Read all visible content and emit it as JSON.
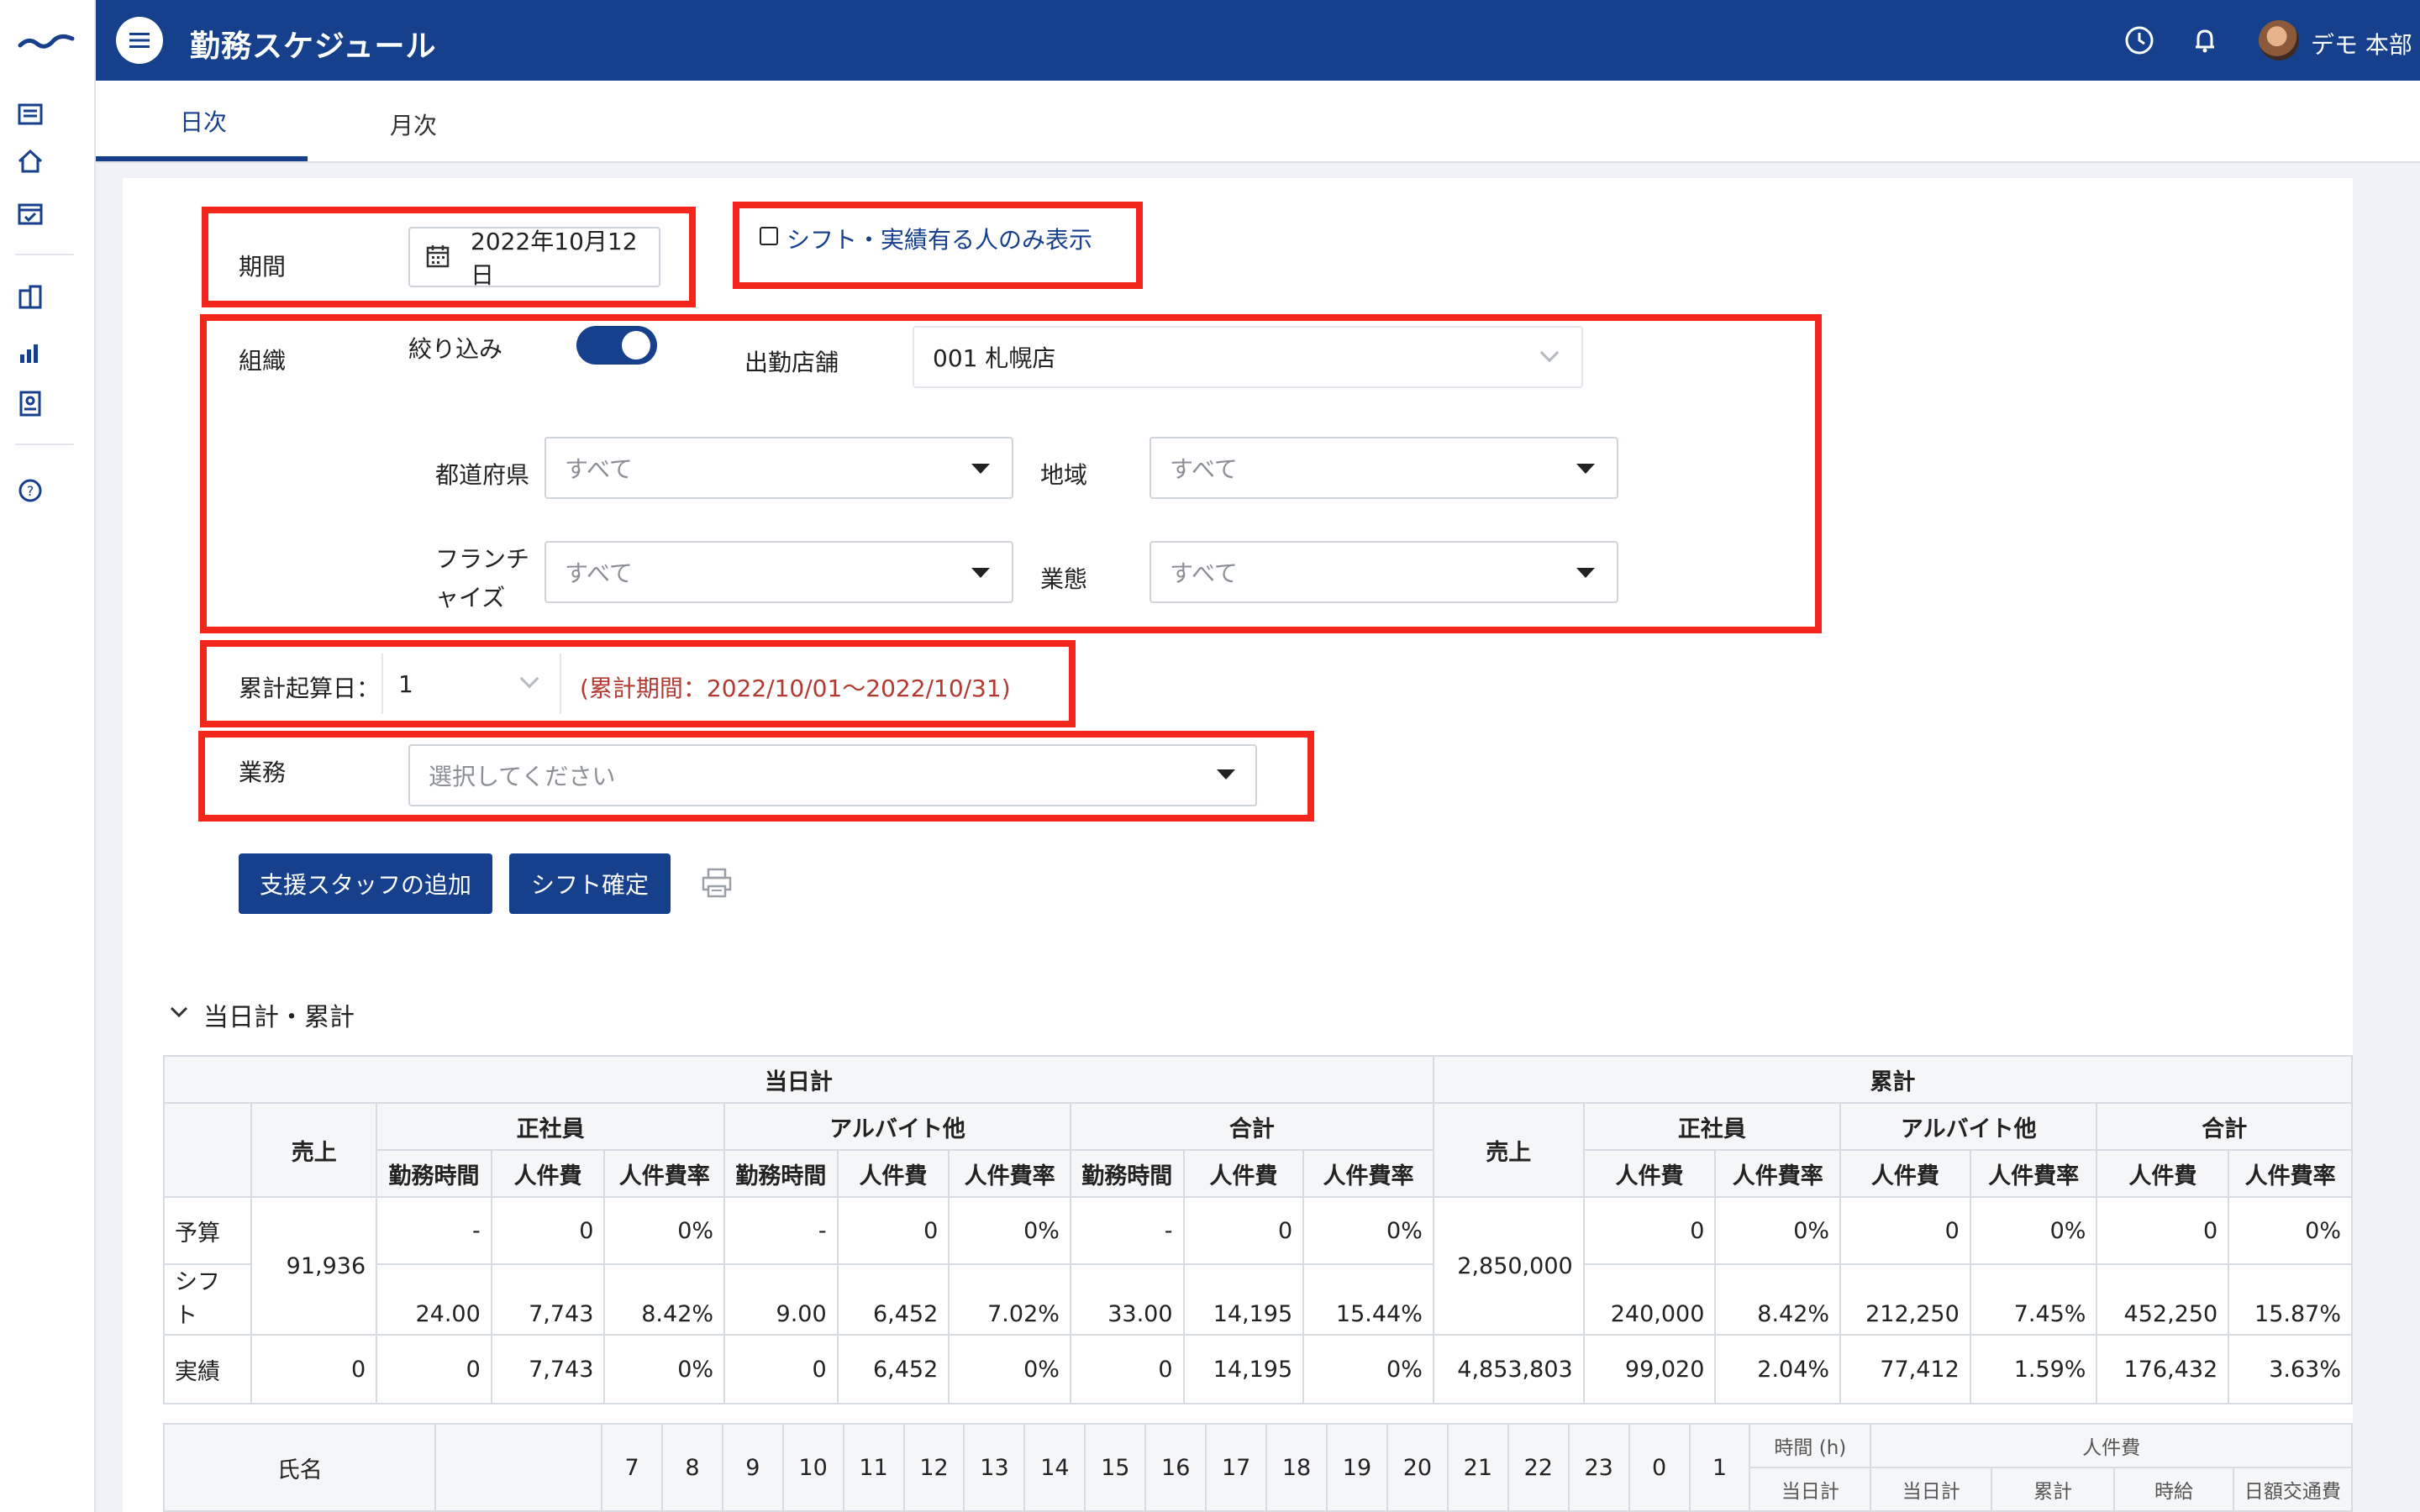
{
  "header": {
    "title": "勤務スケジュール",
    "user_name": "デモ 本部"
  },
  "tabs": [
    {
      "label": "日次",
      "active": true
    },
    {
      "label": "月次",
      "active": false
    }
  ],
  "filters": {
    "period_label": "期間",
    "period_value": "2022年10月12日",
    "shift_only_label": "シフト・実績有る人のみ表示",
    "org_label": "組織",
    "narrow_label": "絞り込み",
    "narrow_on": true,
    "store_label": "出勤店舗",
    "store_value": "001 札幌店",
    "pref_label": "都道府県",
    "pref_value": "すべて",
    "region_label": "地域",
    "region_value": "すべて",
    "franchise_label_1": "フランチ",
    "franchise_label_2": "ャイズ",
    "franchise_value": "すべて",
    "business_type_label": "業態",
    "business_type_value": "すべて",
    "cumulative_label": "累計起算日：",
    "cumulative_value": "1",
    "cumulative_period": "(累計期間：2022/10/01〜2022/10/31)",
    "work_label": "業務",
    "work_placeholder": "選択してください"
  },
  "actions": {
    "add_support_staff": "支援スタッフの追加",
    "confirm_shift": "シフト確定"
  },
  "summary_section": {
    "title": "当日計・累計",
    "groups": {
      "daily": "当日計",
      "cumulative": "累計"
    },
    "col_sales": "売上",
    "col_regular": "正社員",
    "col_part": "アルバイト他",
    "col_total": "合計",
    "col_hours": "勤務時間",
    "col_cost": "人件費",
    "col_rate": "人件費率",
    "rows": [
      {
        "label": "予算",
        "daily": [
          "-",
          "0",
          "0%",
          "-",
          "0",
          "0%",
          "-",
          "0",
          "0%"
        ],
        "cumulative": [
          "0",
          "0%",
          "0",
          "0%",
          "0",
          "0%"
        ]
      },
      {
        "label": "シフト",
        "daily": [
          "24.00",
          "7,743",
          "8.42%",
          "9.00",
          "6,452",
          "7.02%",
          "33.00",
          "14,195",
          "15.44%"
        ],
        "cumulative": [
          "240,000",
          "8.42%",
          "212,250",
          "7.45%",
          "452,250",
          "15.87%"
        ]
      },
      {
        "label": "実績",
        "daily_sales": "0",
        "daily": [
          "0",
          "7,743",
          "0%",
          "0",
          "6,452",
          "0%",
          "0",
          "14,195",
          "0%"
        ],
        "cumulative_sales": "4,853,803",
        "cumulative": [
          "99,020",
          "2.04%",
          "77,412",
          "1.59%",
          "176,432",
          "3.63%"
        ]
      }
    ],
    "daily_sales_budget_shift": "91,936",
    "cumulative_sales_budget_shift": "2,850,000"
  },
  "schedule_table": {
    "name_header": "氏名",
    "hours": [
      "7",
      "8",
      "9",
      "10",
      "11",
      "12",
      "13",
      "14",
      "15",
      "16",
      "17",
      "18",
      "19",
      "20",
      "21",
      "22",
      "23",
      "0",
      "1"
    ],
    "time_header": "時間 (h)",
    "time_sub": "当日計",
    "cost_header": "人件費",
    "cost_subs": [
      "当日計",
      "累計",
      "時給",
      "日額交通費"
    ]
  }
}
